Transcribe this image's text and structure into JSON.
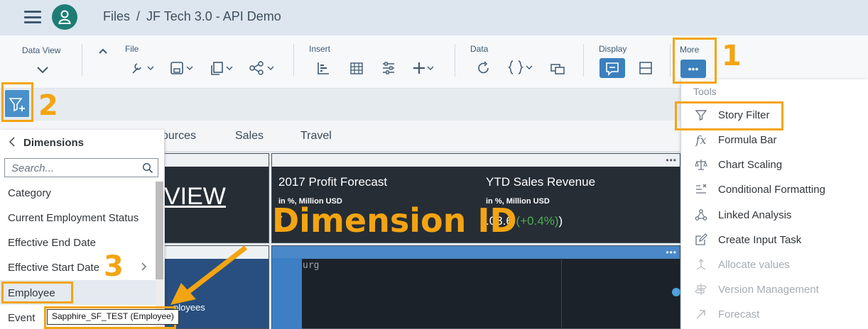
{
  "shell": {
    "breadcrumb": [
      "Files",
      "JF Tech 3.0 -  API Demo"
    ],
    "breadcrumb_sep": "/"
  },
  "toolbar": {
    "data_view_label": "Data View",
    "file_label": "File",
    "insert_label": "Insert",
    "data_label": "Data",
    "display_label": "Display",
    "more_label": "More",
    "more_button_text": "•••"
  },
  "tabs": [
    "ources",
    "Sales",
    "Travel"
  ],
  "tiles": {
    "view_title": "VIEW",
    "profit_title": "2017 Profit Forecast",
    "profit_sub": "in %, Million USD",
    "revenue_title": "YTD Sales Revenue",
    "revenue_sub": "in %, Million USD",
    "revenue_value": ".03.6",
    "revenue_delta": "(+0.4%)",
    "revenue_close": ")",
    "profit_value_partial": "(",
    "map_label": "urg",
    "employees_label": "ployees"
  },
  "dimensions": {
    "title": "Dimensions",
    "search_placeholder": "Search...",
    "items": [
      "Category",
      "Current Employment Status",
      "Effective End Date",
      "Effective Start Date",
      "Employee",
      "Event"
    ]
  },
  "tools_menu": {
    "header": "Tools",
    "items": [
      {
        "label": "Story Filter",
        "icon": "funnel-icon",
        "enabled": true
      },
      {
        "label": "Formula Bar",
        "icon": "fx-icon",
        "enabled": true
      },
      {
        "label": "Chart Scaling",
        "icon": "scale-icon",
        "enabled": true
      },
      {
        "label": "Conditional Formatting",
        "icon": "conditional-format-icon",
        "enabled": true
      },
      {
        "label": "Linked Analysis",
        "icon": "linked-analysis-icon",
        "enabled": true
      },
      {
        "label": "Create Input Task",
        "icon": "edit-icon",
        "enabled": true
      },
      {
        "label": "Allocate values",
        "icon": "allocate-icon",
        "enabled": false
      },
      {
        "label": "Version Management",
        "icon": "version-icon",
        "enabled": false
      },
      {
        "label": "Forecast",
        "icon": "forecast-icon",
        "enabled": false
      }
    ]
  },
  "annotations": {
    "num1": "1",
    "num2": "2",
    "num3": "3",
    "big_label": "Dimension ID",
    "tooltip": "Sapphire_SF_TEST (Employee)"
  },
  "colors": {
    "accent": "#f3a412",
    "button_blue": "#3b80bd",
    "tile_dark": "#262d35"
  }
}
